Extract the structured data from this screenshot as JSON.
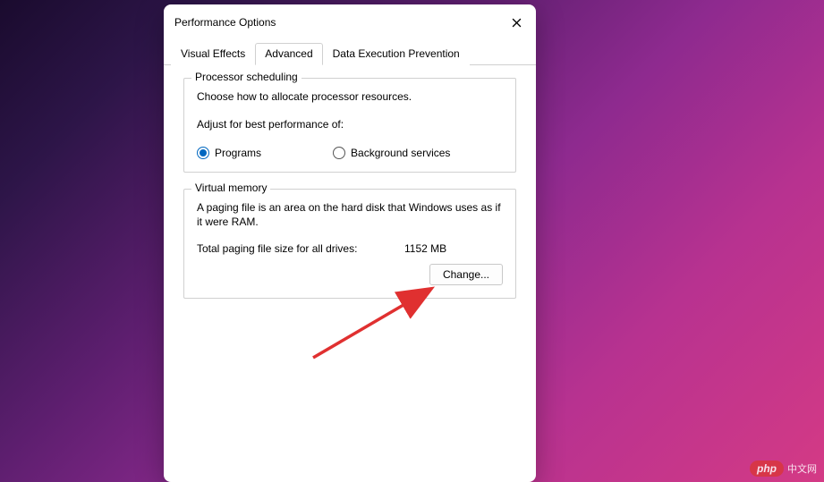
{
  "window": {
    "title": "Performance Options"
  },
  "tabs": {
    "visual_effects": "Visual Effects",
    "advanced": "Advanced",
    "dep": "Data Execution Prevention"
  },
  "processor_group": {
    "title": "Processor scheduling",
    "desc": "Choose how to allocate processor resources.",
    "adjust_label": "Adjust for best performance of:",
    "programs": "Programs",
    "background": "Background services"
  },
  "vm_group": {
    "title": "Virtual memory",
    "desc": "A paging file is an area on the hard disk that Windows uses as if it were RAM.",
    "total_label": "Total paging file size for all drives:",
    "total_value": "1152 MB",
    "change_btn": "Change..."
  },
  "watermark": {
    "brand": "php",
    "suffix": "中文网"
  }
}
